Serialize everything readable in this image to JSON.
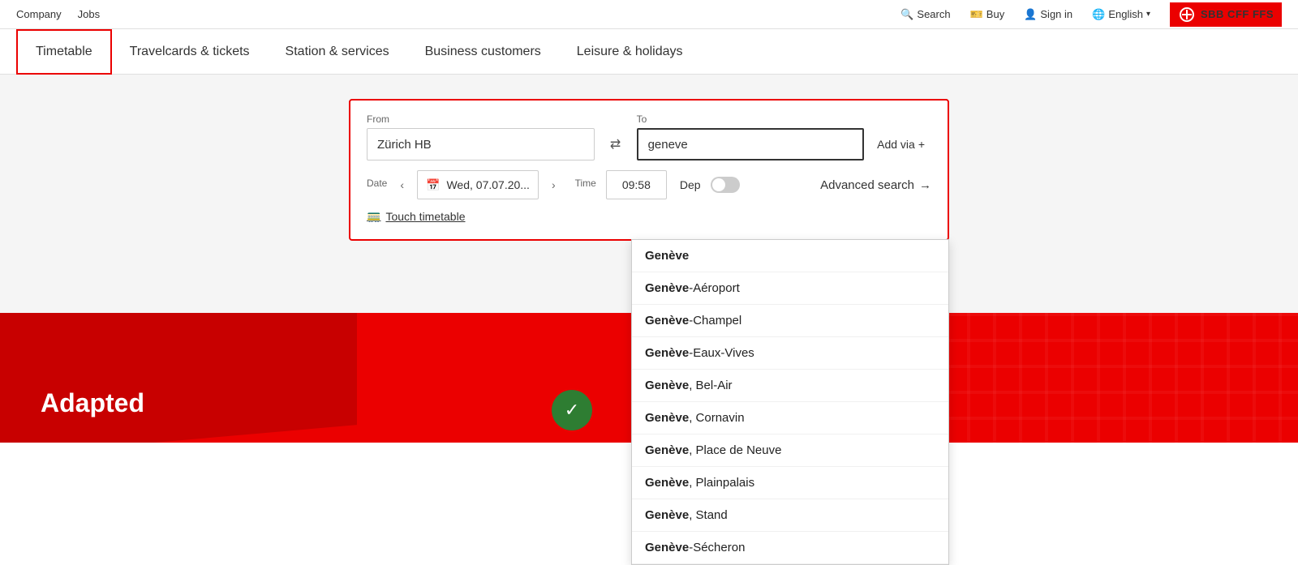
{
  "topbar": {
    "left": {
      "company": "Company",
      "jobs": "Jobs"
    },
    "right": {
      "search": "Search",
      "buy": "Buy",
      "signin": "Sign in",
      "language": "English",
      "logo_text": "SBB CFF FFS"
    }
  },
  "nav": {
    "items": [
      {
        "id": "timetable",
        "label": "Timetable",
        "active": true
      },
      {
        "id": "travelcards",
        "label": "Travelcards & tickets",
        "active": false
      },
      {
        "id": "stations",
        "label": "Station & services",
        "active": false
      },
      {
        "id": "business",
        "label": "Business customers",
        "active": false
      },
      {
        "id": "leisure",
        "label": "Leisure & holidays",
        "active": false
      }
    ]
  },
  "search": {
    "from_label": "From",
    "from_value": "Zürich HB",
    "to_label": "To",
    "to_value": "geneve",
    "add_via": "Add via",
    "date_label": "Date",
    "date_value": "Wed, 07.07.20...",
    "time_label": "Time",
    "time_value": "09:58",
    "dep_label": "Dep",
    "advanced_search": "Advanced search",
    "touch_timetable": "Touch timetable"
  },
  "dropdown": {
    "items": [
      {
        "bold": "Genève",
        "rest": ""
      },
      {
        "bold": "Genève",
        "rest": "-Aéroport"
      },
      {
        "bold": "Genève",
        "rest": "-Champel"
      },
      {
        "bold": "Genève",
        "rest": "-Eaux-Vives"
      },
      {
        "bold": "Genève",
        "rest": ", Bel-Air"
      },
      {
        "bold": "Genève",
        "rest": ", Cornavin"
      },
      {
        "bold": "Genève",
        "rest": ", Place de Neuve"
      },
      {
        "bold": "Genève",
        "rest": ", Plainpalais"
      },
      {
        "bold": "Genève",
        "rest": ", Stand"
      },
      {
        "bold": "Genève",
        "rest": "-Sécheron"
      }
    ]
  },
  "hero": {
    "text": "Adapted"
  },
  "icons": {
    "search": "🔍",
    "buy": "🎫",
    "signin": "👤",
    "globe": "🌐",
    "calendar": "📅",
    "swap": "⇄",
    "plus": "+",
    "arrow_right": "→",
    "arrow_left": "‹",
    "arrow_right_nav": "›",
    "train": "🚃",
    "check": "✓"
  }
}
